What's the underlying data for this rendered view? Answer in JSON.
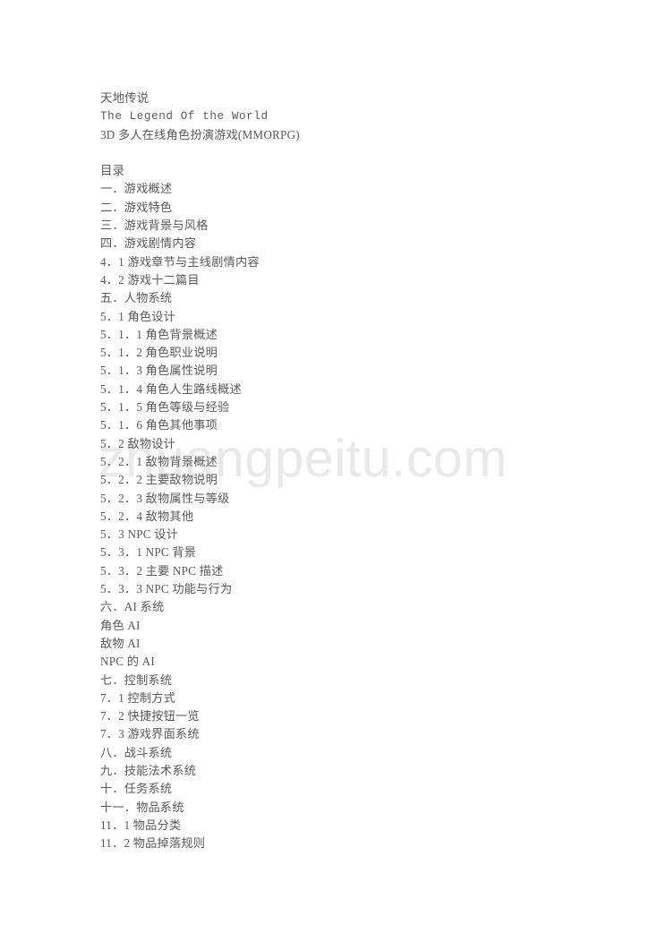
{
  "document": {
    "title_cn": "天地传说",
    "title_en": "The Legend Of the World",
    "subtitle": "3D 多人在线角色扮演游戏(MMORPG)",
    "toc_heading": "目录",
    "watermark": "zhuangpeitu.com",
    "text_color": "#5a5a5a",
    "watermark_color": "#e9e9e9",
    "background_color": "#ffffff"
  },
  "toc": [
    {
      "text": "一．游戏概述"
    },
    {
      "text": "二．游戏特色"
    },
    {
      "text": "三．游戏背景与风格"
    },
    {
      "text": "四．游戏剧情内容"
    },
    {
      "text": "4．1 游戏章节与主线剧情内容"
    },
    {
      "text": "4．2 游戏十二篇目"
    },
    {
      "text": "五．人物系统"
    },
    {
      "text": "5．1 角色设计"
    },
    {
      "text": "5．1．1 角色背景概述"
    },
    {
      "text": "5．1．2 角色职业说明"
    },
    {
      "text": "5．1．3 角色属性说明"
    },
    {
      "text": "5．1．4 角色人生路线概述"
    },
    {
      "text": "5．1．5 角色等级与经验"
    },
    {
      "text": "5．1．6 角色其他事项"
    },
    {
      "text": "5．2 敌物设计"
    },
    {
      "text": "5．2．1 敌物背景概述"
    },
    {
      "text": "5．2．2 主要敌物说明"
    },
    {
      "text": "5．2．3 敌物属性与等级"
    },
    {
      "text": "5．2．4 敌物其他"
    },
    {
      "text": "5．3 NPC 设计"
    },
    {
      "text": "5．3．1 NPC 背景"
    },
    {
      "text": "5．3．2 主要 NPC 描述"
    },
    {
      "text": "5．3．3 NPC 功能与行为"
    },
    {
      "text": "六．AI 系统"
    },
    {
      "text": "角色 AI"
    },
    {
      "text": "敌物 AI"
    },
    {
      "text": "NPC 的 AI"
    },
    {
      "text": "七．控制系统"
    },
    {
      "text": "7．1 控制方式"
    },
    {
      "text": "7．2 快捷按钮一览"
    },
    {
      "text": "7．3 游戏界面系统"
    },
    {
      "text": "八．战斗系统"
    },
    {
      "text": "九．技能法术系统"
    },
    {
      "text": "十．任务系统"
    },
    {
      "text": "十一．物品系统"
    },
    {
      "text": "11．1 物品分类"
    },
    {
      "text": "11．2 物品掉落规则"
    }
  ]
}
